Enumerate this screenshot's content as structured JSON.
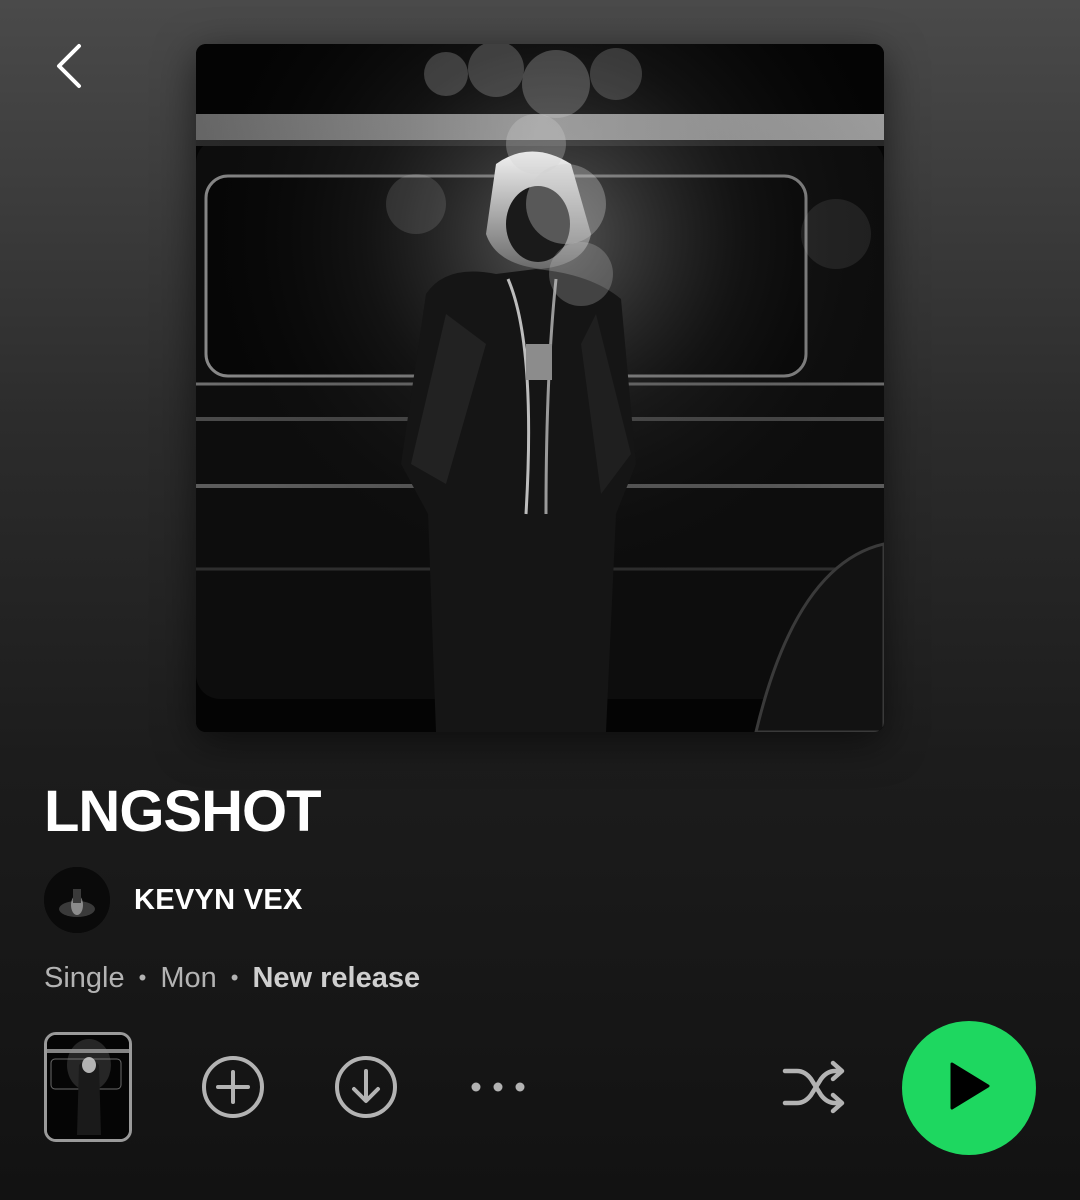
{
  "header": {
    "back_icon": "chevron-left-icon"
  },
  "album": {
    "title": "LNGSHOT",
    "cover_alt": "Album cover art"
  },
  "artist": {
    "name": "KEVYN VEX"
  },
  "meta": {
    "type": "Single",
    "date": "Mon",
    "badge": "New release",
    "separator": "•"
  },
  "actions": {
    "add_icon": "add-circle-icon",
    "download_icon": "download-circle-icon",
    "more_icon": "more-options-icon",
    "shuffle_icon": "shuffle-icon",
    "play_icon": "play-icon"
  },
  "colors": {
    "accent": "#1ed760",
    "text_primary": "#ffffff",
    "text_secondary": "#b3b3b3"
  }
}
